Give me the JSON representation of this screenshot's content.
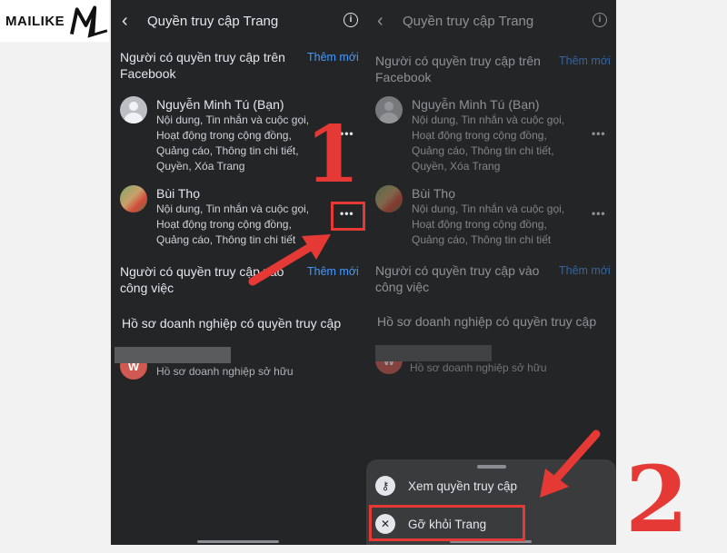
{
  "logo": {
    "text": "MAILIKE"
  },
  "screen": {
    "header": {
      "title": "Quyền truy cập Trang"
    },
    "facebook_section": {
      "heading": "Người có quyền truy cập trên Facebook",
      "add_link": "Thêm mới",
      "people": [
        {
          "name": "Nguyễn Minh Tú (Bạn)",
          "permissions": "Nội dung, Tin nhắn và cuộc gọi, Hoạt động trong cộng đồng, Quảng cáo, Thông tin chi tiết, Quyền, Xóa Trang"
        },
        {
          "name": "Bùi Thọ",
          "permissions": "Nội dung, Tin nhắn và cuộc gọi, Hoạt động trong cộng đồng, Quảng cáo, Thông tin chi tiết"
        }
      ]
    },
    "task_section": {
      "heading": "Người có quyền truy cập vào công việc",
      "add_link": "Thêm mới"
    },
    "business_section": {
      "heading": "Hồ sơ doanh nghiệp có quyền truy cập",
      "item_subtitle": "Hồ sơ doanh nghiệp sở hữu"
    },
    "more_label": "•••"
  },
  "bottom_sheet": {
    "items": [
      {
        "label": "Xem quyền truy cập",
        "icon": "key-icon"
      },
      {
        "label": "Gỡ khỏi Trang",
        "icon": "remove-circle-icon"
      }
    ]
  },
  "annotations": {
    "step1": "1",
    "step2": "2",
    "color": "#e53935"
  }
}
